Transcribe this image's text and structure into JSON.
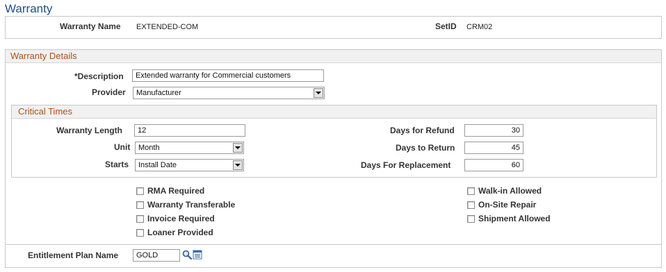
{
  "page": {
    "title": "Warranty"
  },
  "header_box": {
    "warranty_name_label": "Warranty Name",
    "warranty_name_value": "EXTENDED-COM",
    "setid_label": "SetID",
    "setid_value": "CRM02"
  },
  "details": {
    "section_title": "Warranty Details",
    "description_label": "*Description",
    "description_value": "Extended warranty for Commercial customers",
    "provider_label": "Provider",
    "provider_value": "Manufacturer"
  },
  "critical": {
    "section_title": "Critical Times",
    "warranty_length_label": "Warranty Length",
    "warranty_length_value": "12",
    "unit_label": "Unit",
    "unit_value": "Month",
    "starts_label": "Starts",
    "starts_value": "Install Date",
    "days_refund_label": "Days for Refund",
    "days_refund_value": "30",
    "days_return_label": "Days to Return",
    "days_return_value": "45",
    "days_replacement_label": "Days For Replacement",
    "days_replacement_value": "60"
  },
  "checkboxes": {
    "rma_required": "RMA Required",
    "warranty_transferable": "Warranty Transferable",
    "invoice_required": "Invoice Required",
    "loaner_provided": "Loaner Provided",
    "walkin_allowed": "Walk-in Allowed",
    "onsite_repair": "On-Site Repair",
    "shipment_allowed": "Shipment Allowed"
  },
  "entitlement": {
    "label": "Entitlement Plan Name",
    "value": "GOLD"
  },
  "icons": {
    "lookup": "magnifier-icon",
    "detail": "detail-page-icon"
  }
}
